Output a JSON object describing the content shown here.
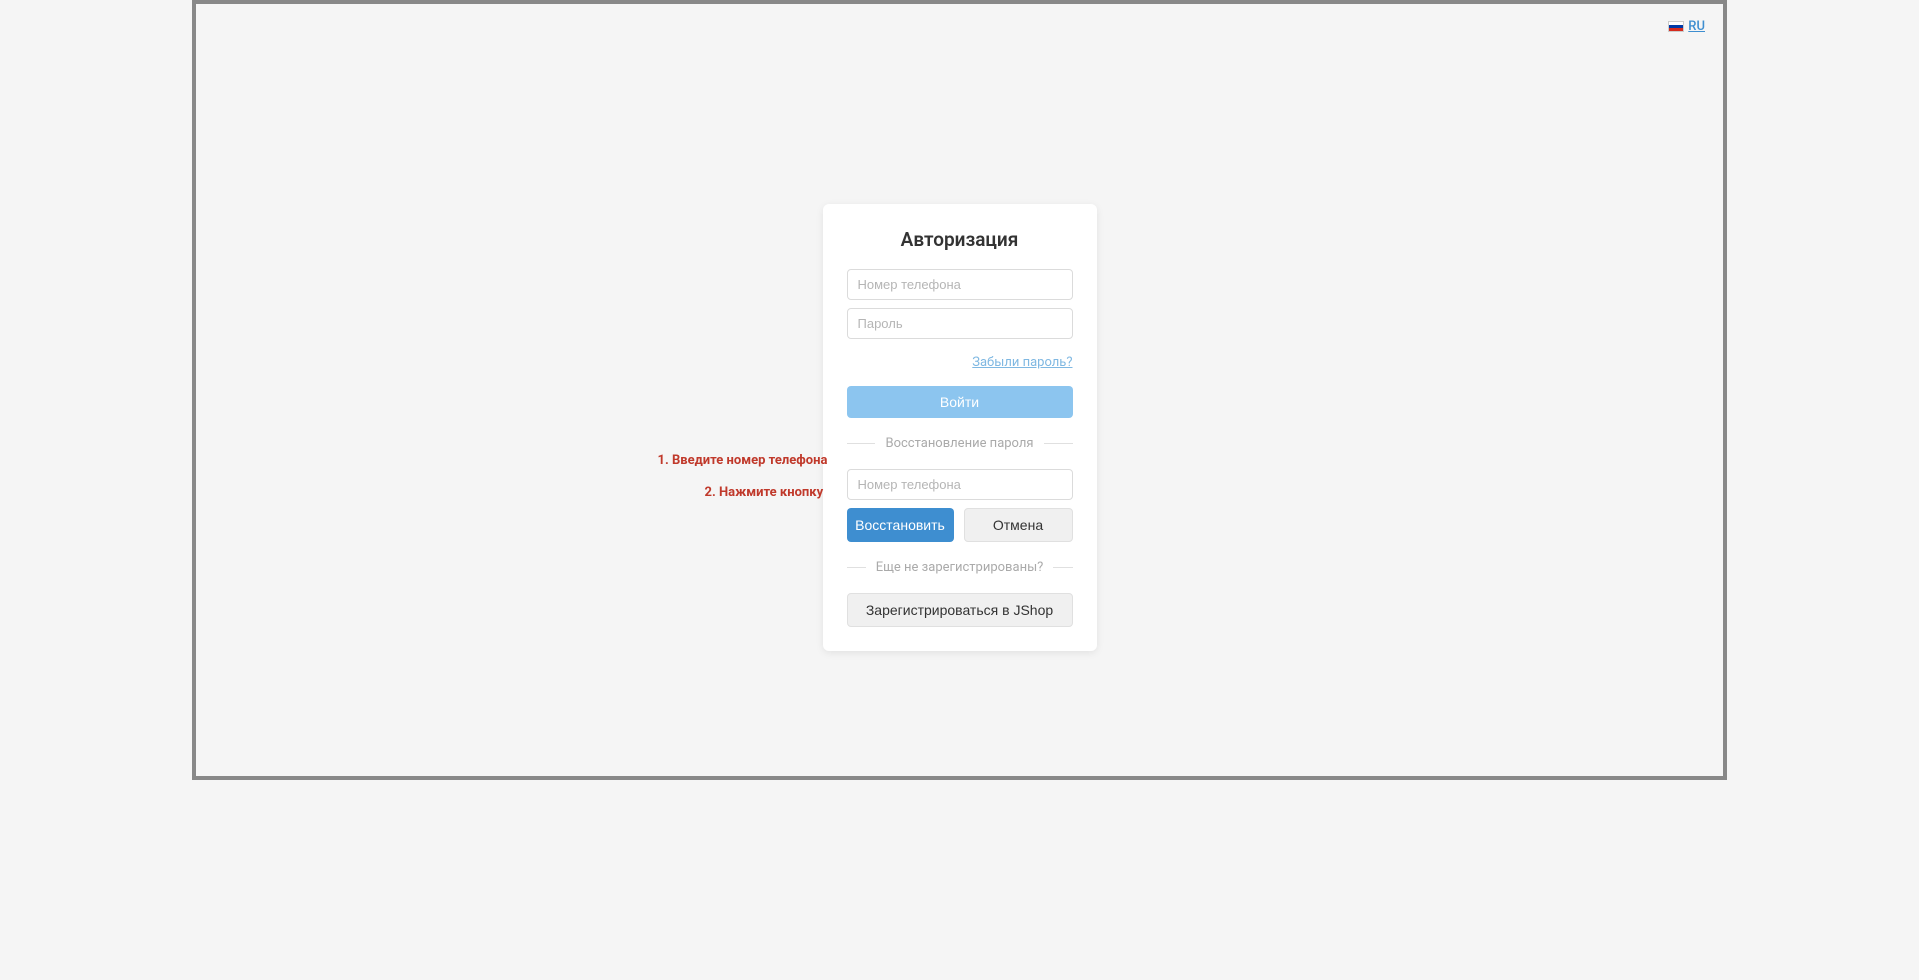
{
  "lang": {
    "code": "RU"
  },
  "auth": {
    "title": "Авторизация",
    "phone_placeholder": "Номер телефона",
    "password_placeholder": "Пароль",
    "forgot_password": "Забыли пароль?",
    "login_button": "Войти"
  },
  "recovery": {
    "divider_title": "Восстановление пароля",
    "phone_placeholder": "Номер телефона",
    "recover_button": "Восстановить",
    "cancel_button": "Отмена"
  },
  "register": {
    "divider_title": "Еще не зарегистрированы?",
    "register_button": "Зарегистрироваться в JShop"
  },
  "annotations": {
    "step1": "1. Введите номер телефона",
    "step2": "2. Нажмите кнопку"
  }
}
